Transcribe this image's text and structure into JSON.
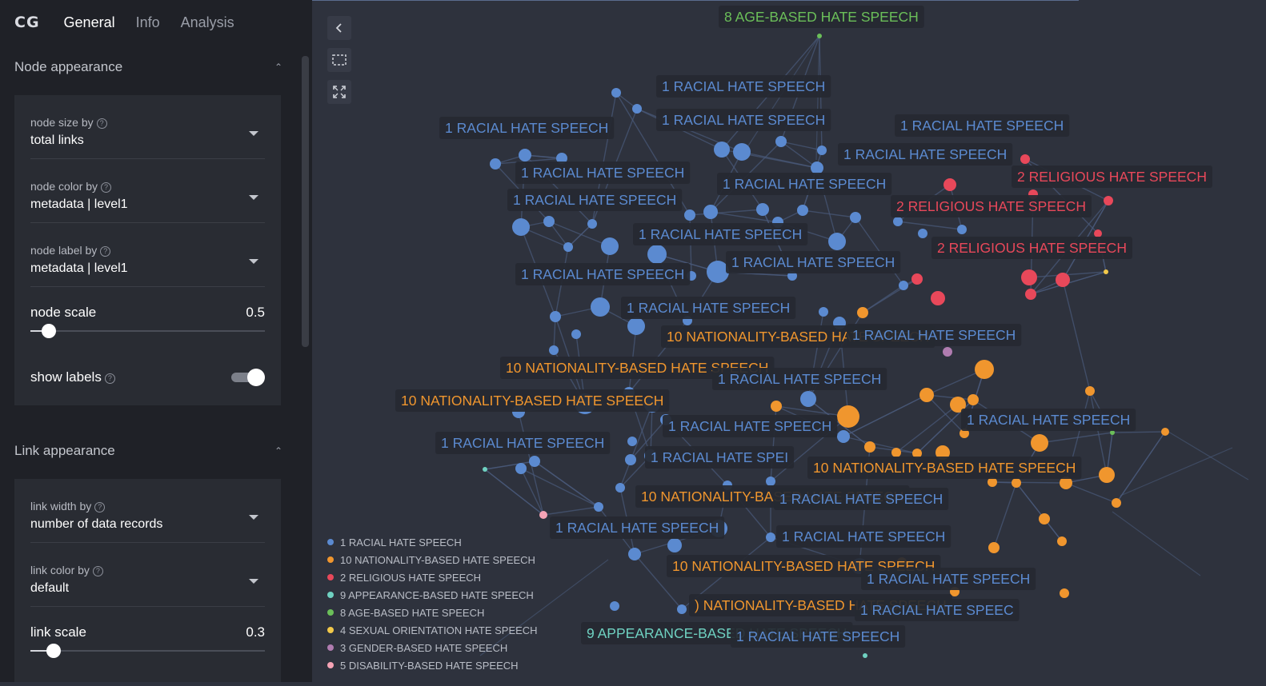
{
  "nav": {
    "logo": "CG",
    "tabs": [
      "General",
      "Info",
      "Analysis"
    ]
  },
  "node_section": {
    "title": "Node appearance",
    "size_by": {
      "label": "node size by",
      "value": "total links"
    },
    "color_by": {
      "label": "node color by",
      "value": "metadata | level1"
    },
    "label_by": {
      "label": "node label by",
      "value": "metadata | level1"
    },
    "scale": {
      "label": "node scale",
      "value": "0.5",
      "fraction": 0.08
    },
    "show_labels": {
      "label": "show labels",
      "on": true
    }
  },
  "link_section": {
    "title": "Link appearance",
    "width_by": {
      "label": "link width by",
      "value": "number of data records"
    },
    "color_by": {
      "label": "link color by",
      "value": "default"
    },
    "scale": {
      "label": "link scale",
      "value": "0.3",
      "fraction": 0.1
    }
  },
  "colors": {
    "racial": "#5b8ad0",
    "nationality": "#f0962e",
    "religious": "#e8485a",
    "appearance": "#6fd1c1",
    "age": "#6bbf59",
    "sexual": "#f2c84a",
    "gender": "#b07cb0",
    "disability": "#f5a3b5",
    "link": "#4a5a7a"
  },
  "legend": [
    {
      "label": "1 RACIAL HATE SPEECH",
      "color": "#5b8ad0"
    },
    {
      "label": "10 NATIONALITY-BASED HATE SPEECH",
      "color": "#f0962e"
    },
    {
      "label": "2 RELIGIOUS HATE SPEECH",
      "color": "#e8485a"
    },
    {
      "label": "9 APPEARANCE-BASED HATE SPEECH",
      "color": "#6fd1c1"
    },
    {
      "label": "8 AGE-BASED HATE SPEECH",
      "color": "#6bbf59"
    },
    {
      "label": "4 SEXUAL ORIENTATION HATE SPEECH",
      "color": "#f2c84a"
    },
    {
      "label": "3 GENDER-BASED HATE SPEECH",
      "color": "#b07cb0"
    },
    {
      "label": "5 DISABILITY-BASED HATE SPEECH",
      "color": "#f5a3b5"
    }
  ],
  "graph_labels": [
    {
      "text": "8 AGE-BASED HATE SPEECH",
      "cat": "age"
    },
    {
      "text": "1 RACIAL HATE SPEECH",
      "cat": "racial"
    },
    {
      "text": "1 RACIAL HATE SPEECH",
      "cat": "racial"
    },
    {
      "text": "1 RACIAL HATE SPEECH",
      "cat": "racial"
    },
    {
      "text": "1 RACIAL HATE SPEECH",
      "cat": "racial"
    },
    {
      "text": "1 RACIAL HATE SPEECH",
      "cat": "racial"
    },
    {
      "text": "2 RELIGIOUS HATE SPEECH",
      "cat": "religious"
    },
    {
      "text": "1 RACIAL HATE SPEECH",
      "cat": "racial"
    },
    {
      "text": "1 RACIAL HATE SPEECH",
      "cat": "racial"
    },
    {
      "text": "2 RELIGIOUS HATE SPEECH",
      "cat": "religious"
    },
    {
      "text": "1 RACIAL HATE SPEECH",
      "cat": "racial"
    },
    {
      "text": "2 RELIGIOUS HATE SPEECH",
      "cat": "religious"
    },
    {
      "text": "1 RACIAL HATE SPEECH",
      "cat": "racial"
    },
    {
      "text": "1 RACIAL HATE SPEECH",
      "cat": "racial"
    },
    {
      "text": "1 RACIAL HATE SPEECH",
      "cat": "racial"
    },
    {
      "text": "1 RACIAL HATE SPEECH",
      "cat": "racial"
    },
    {
      "text": "10 NATIONALITY-BASED HATE SPEECH",
      "cat": "nationality"
    },
    {
      "text": "1 RACIAL HATE SPEECH",
      "cat": "racial"
    },
    {
      "text": "10 NATIONALITY-BASED HATE SPEECH",
      "cat": "nationality"
    },
    {
      "text": "1 RACIAL HATE SPEECH",
      "cat": "racial"
    },
    {
      "text": "10 NATIONALITY-BASED HATE SPEECH",
      "cat": "nationality"
    },
    {
      "text": "1 RACIAL HATE SPEECH",
      "cat": "racial"
    },
    {
      "text": "1 RACIAL HATE SPEECH",
      "cat": "racial"
    },
    {
      "text": "1 RACIAL HATE SPEECH",
      "cat": "racial"
    },
    {
      "text": "10 NATIONALITY-BASED HATE SPEECH",
      "cat": "nationality"
    },
    {
      "text": "1 RACIAL HATE SPEI",
      "cat": "racial"
    },
    {
      "text": "10 NATIONALITY-BASED HATE SPEECH",
      "cat": "nationality"
    },
    {
      "text": "1 RACIAL HATE SPEECH",
      "cat": "racial"
    },
    {
      "text": "1 RACIAL HATE SPEECH",
      "cat": "racial"
    },
    {
      "text": "1 RACIAL HATE SPEECH",
      "cat": "racial"
    },
    {
      "text": "10 NATIONALITY-BASED HATE SPEECH",
      "cat": "nationality"
    },
    {
      "text": "1 RACIAL HATE SPEECH",
      "cat": "racial"
    },
    {
      "text": ") NATIONALITY-BASED HATE SPEECH",
      "cat": "nationality"
    },
    {
      "text": "1 RACIAL HATE SPEEC",
      "cat": "racial"
    },
    {
      "text": "9 APPEARANCE-BASED HATE SPEECH",
      "cat": "appearance"
    },
    {
      "text": "1 RACIAL HATE SPEECH",
      "cat": "racial"
    }
  ]
}
